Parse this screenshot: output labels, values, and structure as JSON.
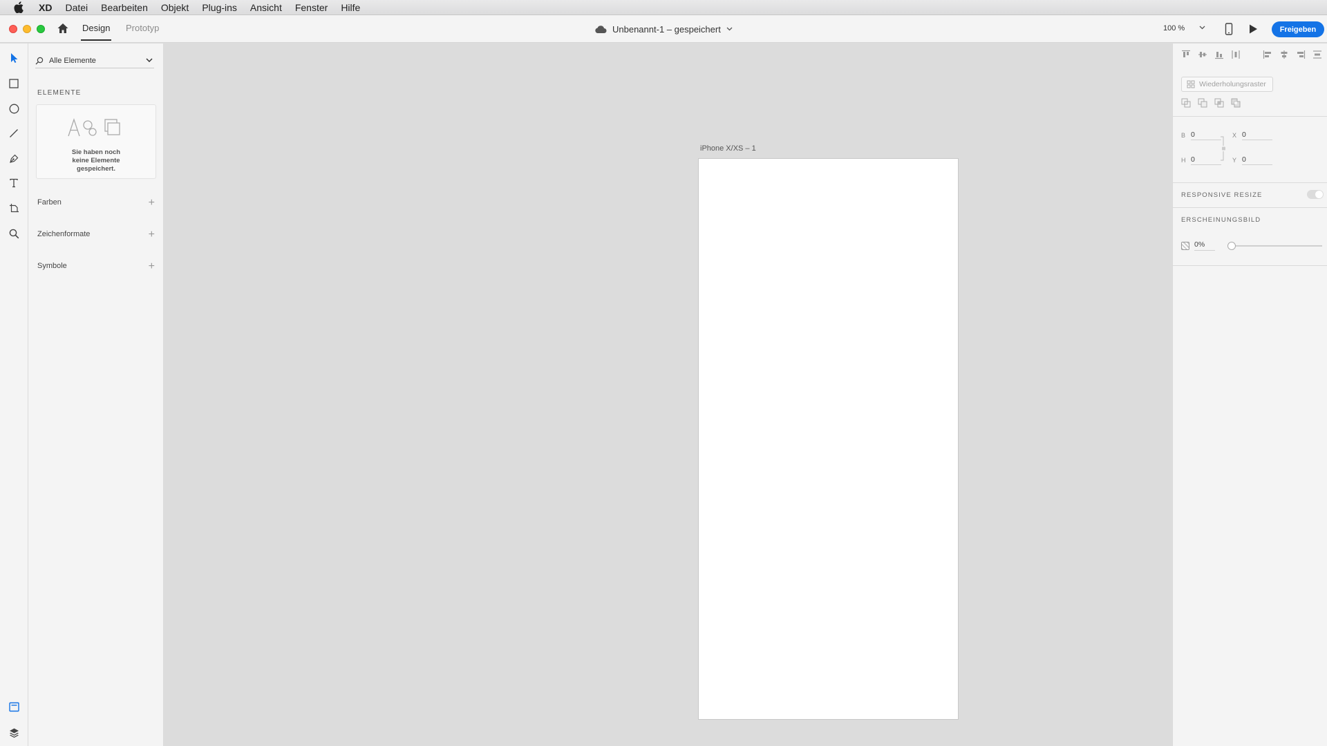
{
  "menubar": {
    "app_name": "XD",
    "items": [
      "Datei",
      "Bearbeiten",
      "Objekt",
      "Plug-ins",
      "Ansicht",
      "Fenster",
      "Hilfe"
    ]
  },
  "titlebar": {
    "tabs": {
      "design": "Design",
      "prototype": "Prototyp"
    },
    "document_title": "Unbenannt-1 – gespeichert",
    "zoom": "100 %",
    "share_label": "Freigeben",
    "accent_color": "#1473e6"
  },
  "toolbar": {
    "tools": [
      "select-tool",
      "rectangle-tool",
      "ellipse-tool",
      "line-tool",
      "pen-tool",
      "text-tool",
      "artboard-tool",
      "zoom-tool"
    ],
    "bottom": [
      "assets-panel",
      "layers-panel"
    ]
  },
  "assets": {
    "filter_label": "Alle Elemente",
    "elements_heading": "ELEMENTE",
    "empty_text": "Sie haben noch keine Elemente gespeichert.",
    "sections": {
      "colors": "Farben",
      "character_styles": "Zeichenformate",
      "symbols": "Symbole"
    }
  },
  "canvas": {
    "artboard_label": "iPhone X/XS – 1"
  },
  "properties": {
    "repeat_grid_label": "Wiederholungsraster",
    "width_label": "B",
    "width_value": "0",
    "height_label": "H",
    "height_value": "0",
    "x_label": "X",
    "x_value": "0",
    "y_label": "Y",
    "y_value": "0",
    "responsive_resize": "RESPONSIVE RESIZE",
    "appearance": "ERSCHEINUNGSBILD",
    "opacity_value": "0%"
  }
}
